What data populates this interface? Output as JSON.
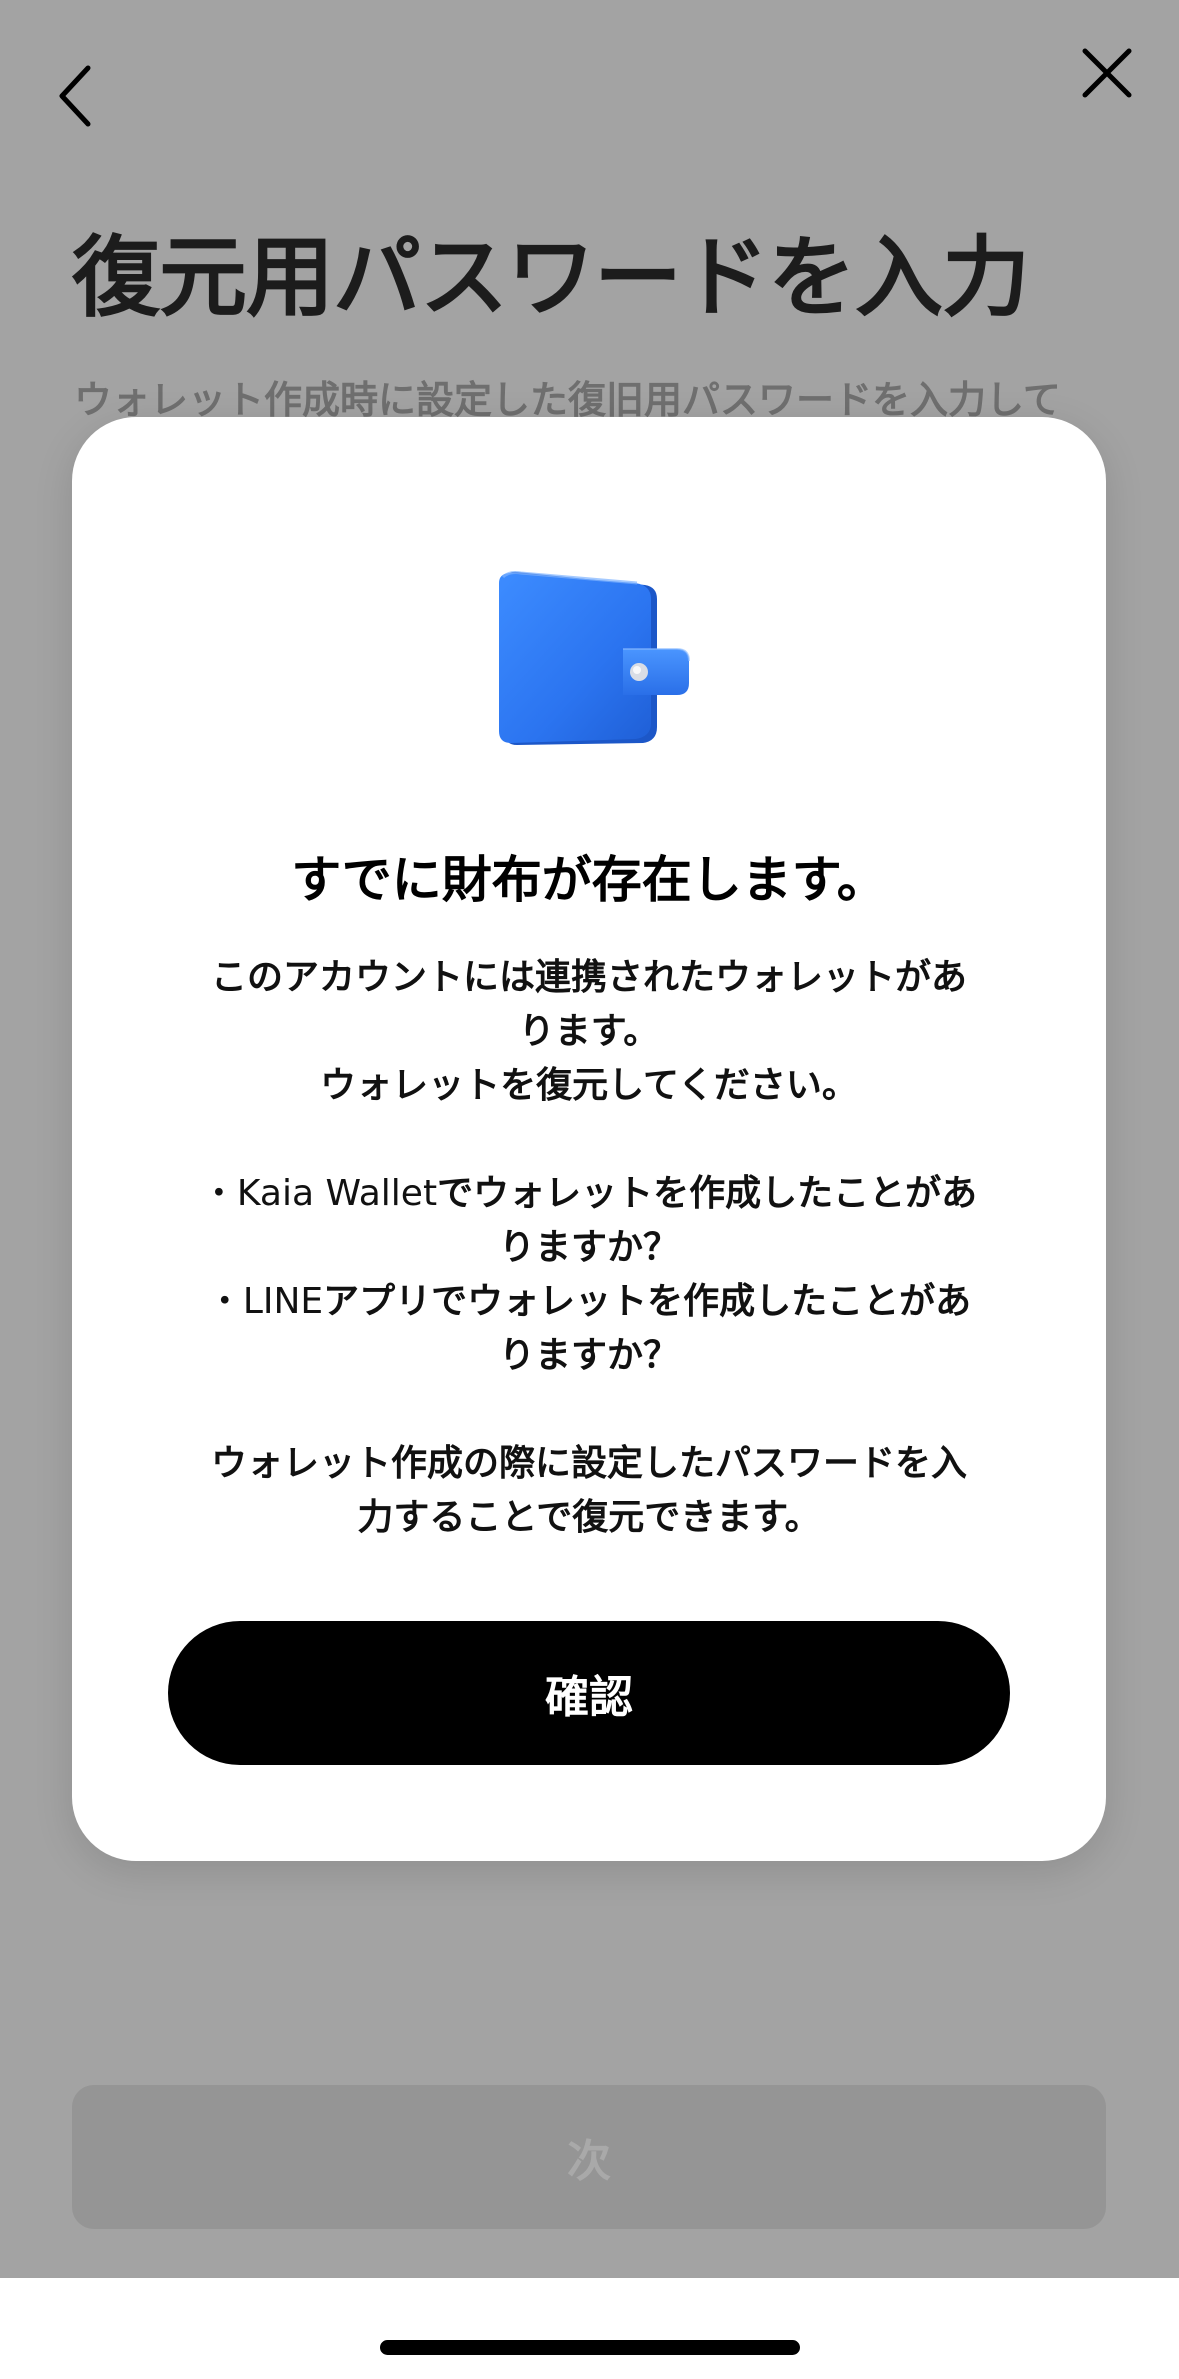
{
  "icons": {
    "back": "chevron-left-icon",
    "close": "close-icon",
    "wallet": "wallet-icon"
  },
  "colors": {
    "overlay_background": "#a3a3a3",
    "modal_background": "#ffffff",
    "confirm_button": "#000000",
    "wallet_blue": "#2f7ff6",
    "disabled_button": "#959595"
  },
  "header": {
    "title": "復元用パスワードを入力",
    "subtitle": "ウォレット作成時に設定した復旧用パスワードを入力して"
  },
  "footer": {
    "next_label": "次"
  },
  "dialog": {
    "title": "すでに財布が存在します。",
    "intro": [
      "このアカウントには連携されたウォレットがあ",
      "ります。",
      "ウォレットを復元してください。"
    ],
    "bullets": [
      {
        "marker": "・",
        "brand": "Kaia Wallet",
        "text": "でウォレットを作成したことがあ",
        "continuation": "りますか？"
      },
      {
        "marker": "・",
        "brand": "LINE",
        "text": "アプリでウォレットを作成したことがあ",
        "continuation": "りますか？"
      }
    ],
    "outro": [
      "ウォレット作成の際に設定したパスワードを入",
      "力することで復元できます。"
    ],
    "confirm_label": "確認"
  }
}
